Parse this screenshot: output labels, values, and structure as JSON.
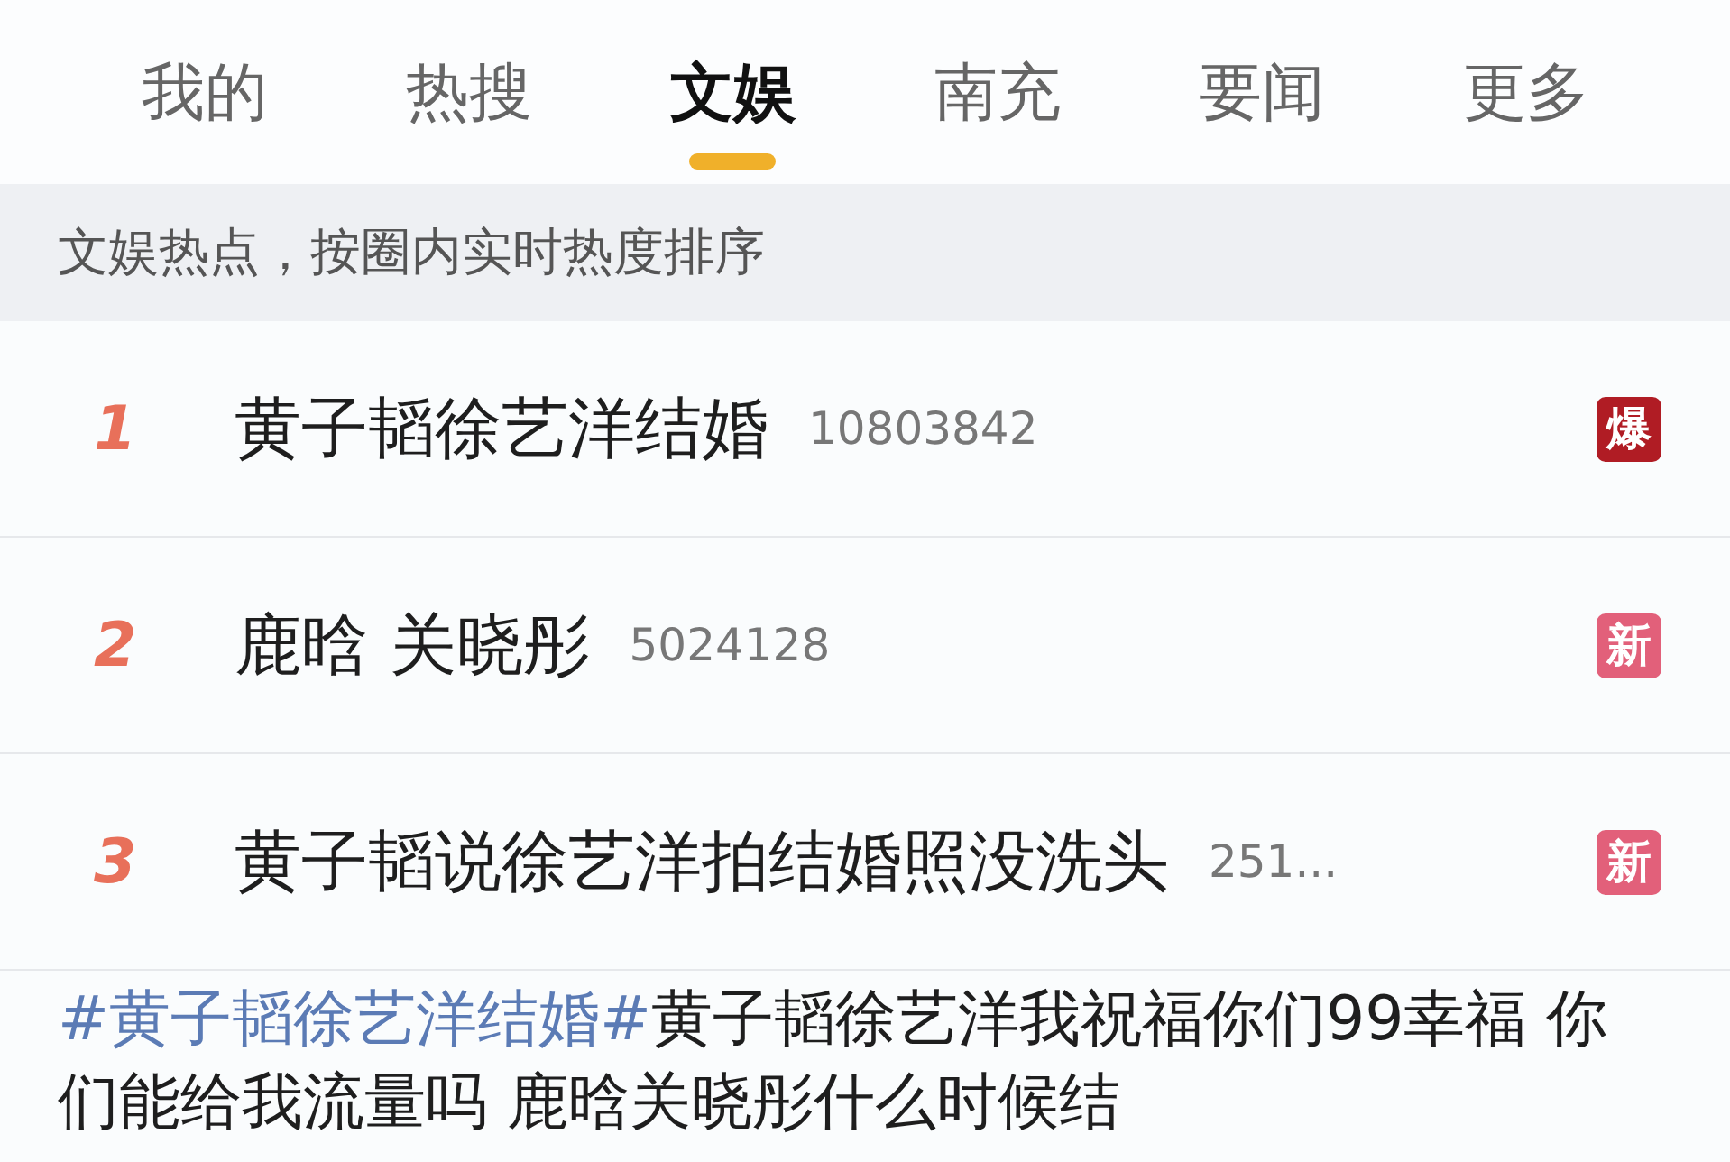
{
  "tabs": [
    {
      "label": "我的",
      "selected": false
    },
    {
      "label": "热搜",
      "selected": false
    },
    {
      "label": "文娱",
      "selected": true
    },
    {
      "label": "南充",
      "selected": false
    },
    {
      "label": "要闻",
      "selected": false
    },
    {
      "label": "更多",
      "selected": false
    }
  ],
  "subtitle": "文娱热点，按圈内实时热度排序",
  "rows": [
    {
      "rank": "1",
      "title": "黄子韬徐艺洋结婚",
      "count": "10803842",
      "badge": "爆",
      "color": "#b01c24"
    },
    {
      "rank": "2",
      "title": "鹿晗 关晓彤",
      "count": "5024128",
      "badge": "新",
      "color": "#e2607a"
    },
    {
      "rank": "3",
      "title": "黄子韬说徐艺洋拍结婚照没洗头",
      "count": "251...",
      "badge": "新",
      "color": "#e2607a"
    }
  ],
  "post": {
    "hashtag": "#黄子韬徐艺洋结婚#",
    "text": "黄子韬徐艺洋我祝福你们99幸福 你们能给我流量吗 鹿晗关晓彤什么时候结"
  }
}
